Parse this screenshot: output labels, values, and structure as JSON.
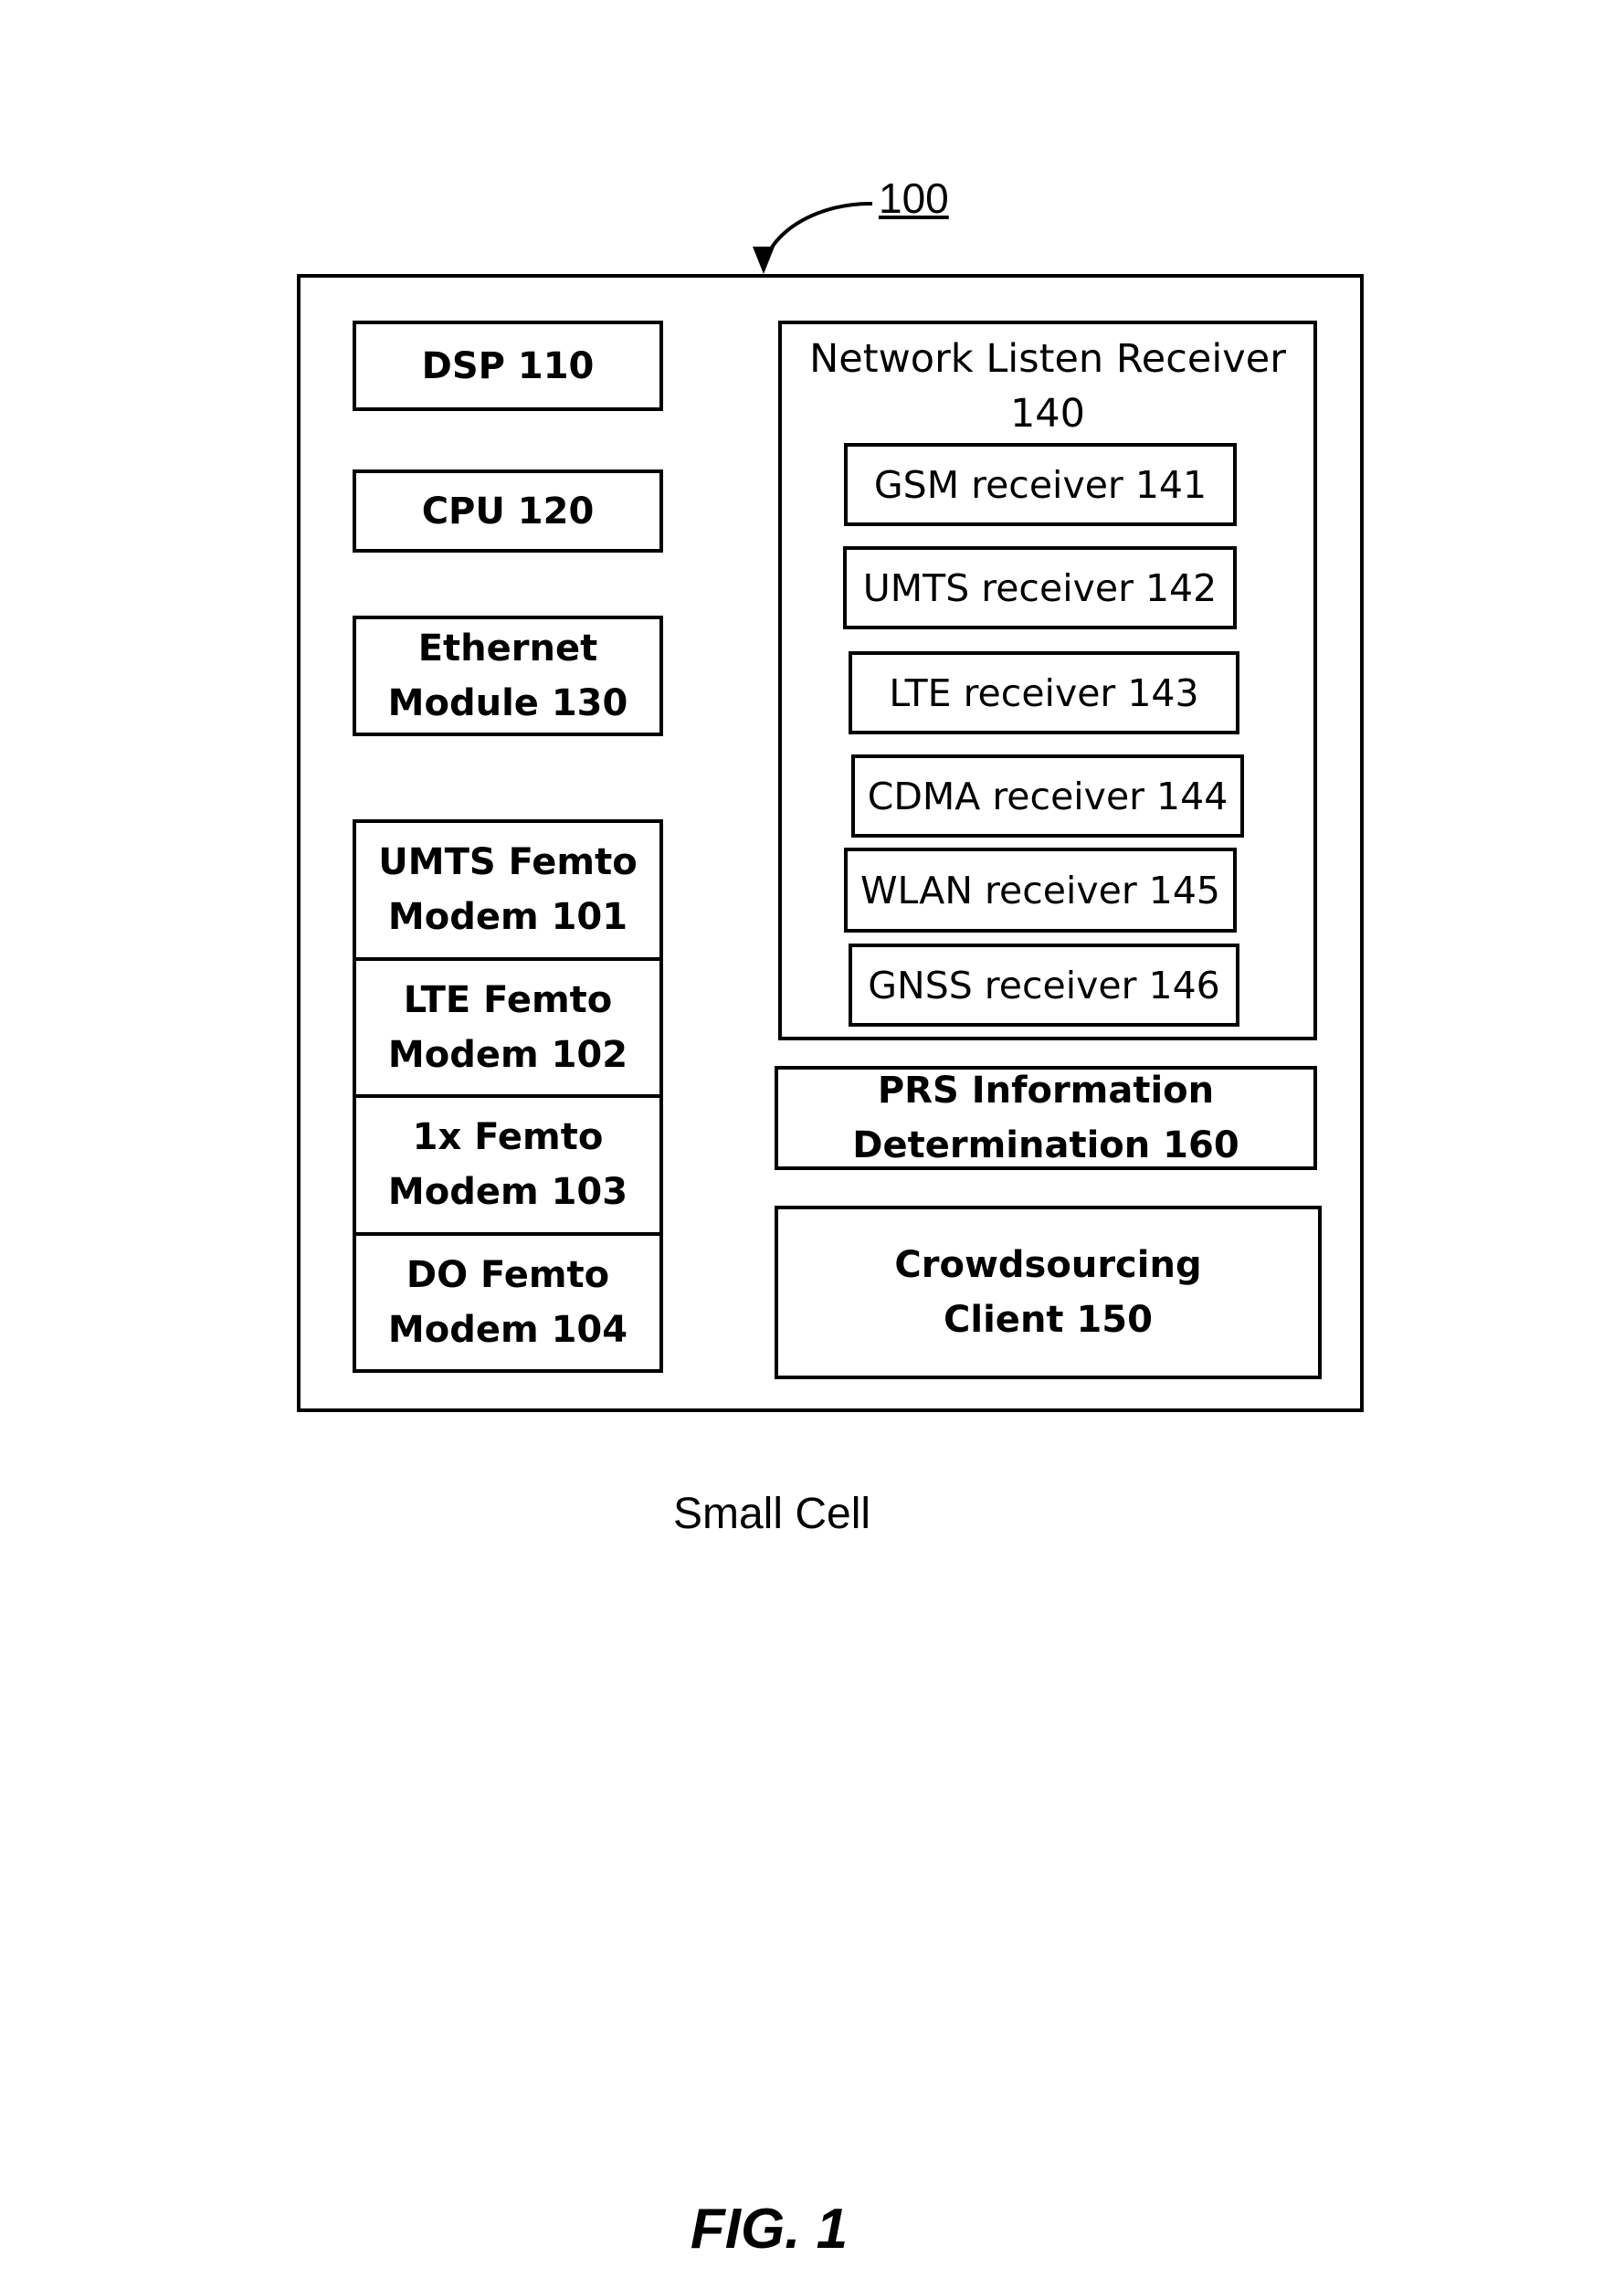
{
  "figure": {
    "reference_numeral": "100",
    "caption": "Small Cell",
    "figure_label": "FIG. 1"
  },
  "left_column": {
    "dsp": "DSP 110",
    "cpu": "CPU 120",
    "ethernet": [
      "Ethernet",
      "Module 130"
    ],
    "modems": [
      [
        "UMTS Femto",
        "Modem 101"
      ],
      [
        "LTE Femto",
        "Modem 102"
      ],
      [
        "1x Femto",
        "Modem 103"
      ],
      [
        "DO Femto",
        "Modem 104"
      ]
    ]
  },
  "network_listen_receiver": {
    "title": [
      "Network Listen Receiver",
      "140"
    ],
    "receivers": [
      "GSM receiver 141",
      "UMTS receiver 142",
      "LTE receiver 143",
      "CDMA receiver 144",
      "WLAN receiver 145",
      "GNSS receiver 146"
    ]
  },
  "right_column": {
    "prs": [
      "PRS Information",
      "Determination 160"
    ],
    "crowdsourcing": [
      "Crowdsourcing",
      "Client 150"
    ]
  }
}
